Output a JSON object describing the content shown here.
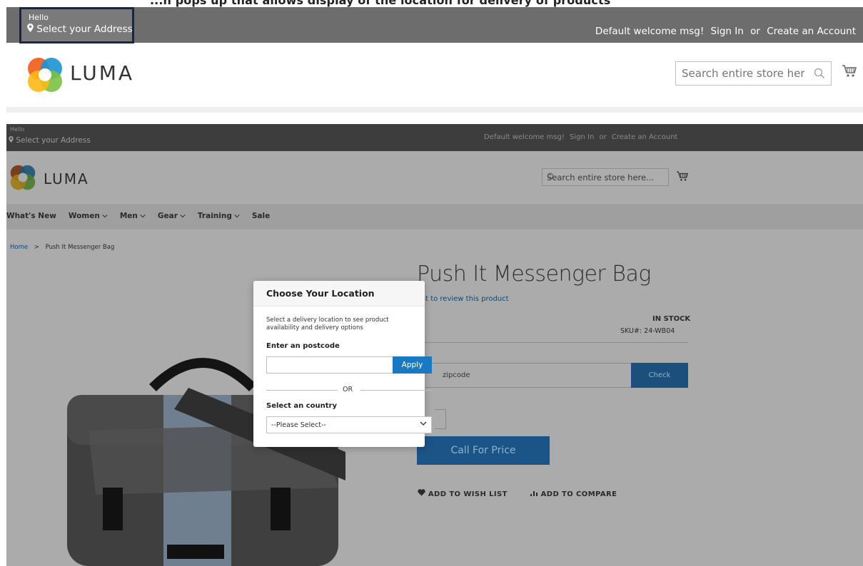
{
  "caption": "...n pops up that allows display of the location for delivery of products",
  "zoom_header": {
    "hello": "Hello",
    "address_label": "Select your Address",
    "welcome": "Default welcome msg!",
    "sign_in": "Sign In",
    "or": "or",
    "create_account": "Create an Account",
    "logo_text": "LUMA",
    "search_placeholder": "Search entire store here..."
  },
  "page": {
    "hello": "Hello",
    "address_label": "Select your Address",
    "welcome": "Default welcome msg!",
    "sign_in": "Sign In",
    "or": "or",
    "create_account": "Create an Account",
    "logo_text": "LUMA",
    "search_placeholder": "Search entire store here...",
    "nav": [
      {
        "label": "What's New",
        "chevron": false
      },
      {
        "label": "Women",
        "chevron": true
      },
      {
        "label": "Men",
        "chevron": true
      },
      {
        "label": "Gear",
        "chevron": true
      },
      {
        "label": "Training",
        "chevron": true
      },
      {
        "label": "Sale",
        "chevron": false
      }
    ],
    "breadcrumb": {
      "home": "Home",
      "separator": ">",
      "current": "Push It Messenger Bag"
    },
    "product_title": "Push It Messenger Bag",
    "review_link": "irst to review this product",
    "stock": "IN STOCK",
    "sku_label": "SKU#:",
    "sku_value": "24-WB04",
    "zip_placeholder": "zipcode",
    "check_button": "Check",
    "call_price_button": "Call For Price",
    "wishlist": "ADD TO WISH LIST",
    "compare": "ADD TO COMPARE"
  },
  "modal": {
    "title": "Choose Your Location",
    "description": "Select a delivery location to see product availability and delivery options",
    "postcode_label": "Enter an postcode",
    "postcode_value": "",
    "apply_button": "Apply",
    "or_text": "OR",
    "country_label": "Select an country",
    "country_selected": "--Please Select--"
  },
  "colors": {
    "accent_blue": "#1979c3",
    "dark_bar": "#3d3d3d",
    "logo_orange": "#f26322",
    "logo_blue": "#1c94d2",
    "logo_green": "#7bc142",
    "logo_yellow": "#fdb913"
  },
  "icons": {
    "pin": "map-pin-icon",
    "search": "search-icon",
    "cart": "cart-icon",
    "heart": "heart-icon",
    "compare": "bar-chart-icon",
    "chevron": "chevron-down-icon"
  }
}
